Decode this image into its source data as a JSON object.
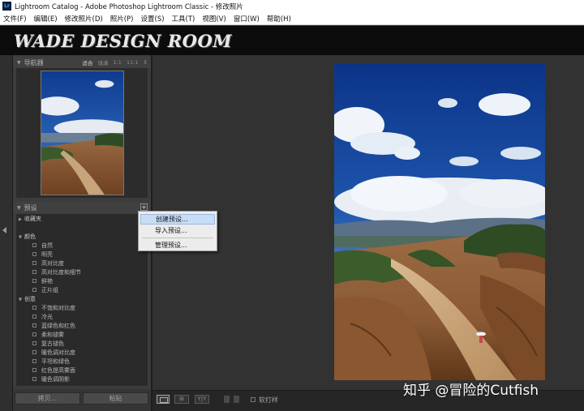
{
  "window": {
    "title": "Lightroom Catalog - Adobe Photoshop Lightroom Classic - 修改照片",
    "app_icon": "Lr"
  },
  "menubar": [
    "文件(F)",
    "编辑(E)",
    "修改照片(D)",
    "照片(P)",
    "设置(S)",
    "工具(T)",
    "视图(V)",
    "窗口(W)",
    "帮助(H)"
  ],
  "identity_plate": "WADE DESIGN ROOM",
  "navigator": {
    "label": "导航器",
    "options": [
      "适合",
      "填满",
      "1:1",
      "11:1"
    ],
    "active_option": "适合"
  },
  "presets": {
    "label": "预设",
    "add_button": "+",
    "collapsed_folder": "收藏夹",
    "groups": [
      {
        "name": "颜色",
        "items": [
          "自然",
          "明亮",
          "高对比度",
          "高对比度和细节",
          "鲜艳",
          "正片组"
        ]
      },
      {
        "name": "创意",
        "items": [
          "不饱和对比度",
          "冷光",
          "蓝绿色和红色",
          "柔和褪雾",
          "复古褪色",
          "暖色调对比度",
          "平坦和绿色",
          "红色提高雾面",
          "暖色调阴影"
        ]
      }
    ]
  },
  "context_menu": {
    "items": [
      "创建预设...",
      "导入预设...",
      "管理预设..."
    ],
    "highlighted": "创建预设..."
  },
  "left_buttons": {
    "copy": "拷贝...",
    "paste": "粘贴"
  },
  "toolbar": {
    "softproof_label": "软打样"
  },
  "watermark": "知乎 @冒险的Cutfish",
  "colors": {
    "sky": "#1c4aa0",
    "ground": "#a0683c",
    "panel": "#3c3c3c",
    "menu_highlight": "#c7dcf5"
  }
}
